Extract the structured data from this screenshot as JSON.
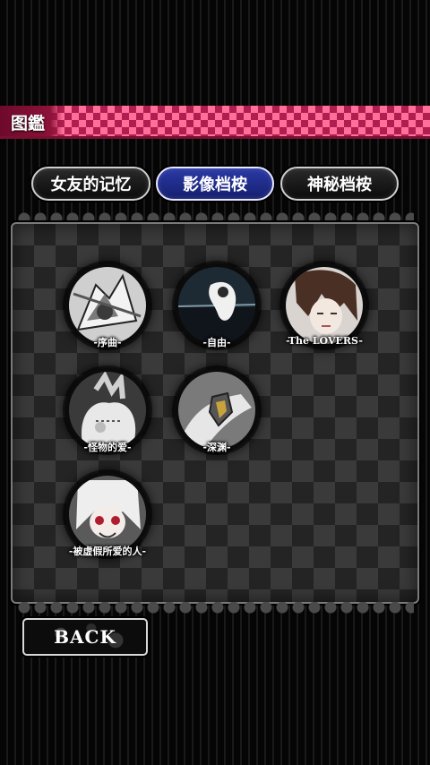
{
  "header": {
    "title": "图鑑"
  },
  "tabs": [
    {
      "label": "女友的记忆",
      "active": false
    },
    {
      "label": "影像档桉",
      "active": true
    },
    {
      "label": "神秘档桉",
      "active": false
    }
  ],
  "gallery": {
    "items": [
      {
        "caption": "-序曲-",
        "icon": "prologue-thumbnail"
      },
      {
        "caption": "-自由-",
        "icon": "freedom-thumbnail"
      },
      {
        "caption": "-The LOVERS-",
        "icon": "lovers-thumbnail"
      },
      {
        "caption": "-怪物的爱-",
        "icon": "monster-love-thumbnail"
      },
      {
        "caption": "-深渊-",
        "icon": "abyss-thumbnail"
      },
      {
        "caption": "-被虚假所爱的人-",
        "icon": "loved-by-falsehood-thumbnail"
      }
    ]
  },
  "back_button": {
    "label": "BACK"
  },
  "colors": {
    "header_accent": "#b01d4f",
    "active_tab": "#1e2b8a"
  }
}
